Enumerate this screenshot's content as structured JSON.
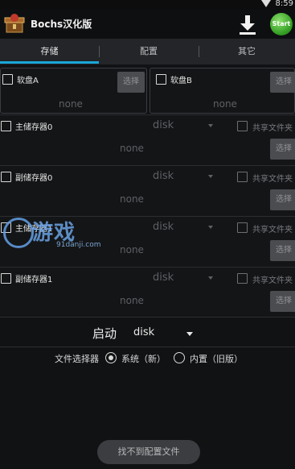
{
  "status": {
    "time": "8:59"
  },
  "app": {
    "title": "Bochs汉化版",
    "start_label": "Start"
  },
  "tabs": [
    {
      "label": "存储"
    },
    {
      "label": "配置"
    },
    {
      "label": "其它"
    }
  ],
  "floppy": [
    {
      "label": "软盘A",
      "button": "选择",
      "value": "none"
    },
    {
      "label": "软盘B",
      "button": "选择",
      "value": "none"
    }
  ],
  "drives": [
    {
      "label": "主储存器0",
      "type": "disk",
      "share": "共享文件夹",
      "button": "选择",
      "value": "none"
    },
    {
      "label": "副储存器0",
      "type": "disk",
      "share": "共享文件夹",
      "button": "选择",
      "value": "none"
    },
    {
      "label": "主储存器1",
      "type": "disk",
      "share": "共享文件夹",
      "button": "选择",
      "value": "none"
    },
    {
      "label": "副储存器1",
      "type": "disk",
      "share": "共享文件夹",
      "button": "选择",
      "value": "none"
    }
  ],
  "boot": {
    "label": "启动",
    "value": "disk"
  },
  "file_selector": {
    "label": "文件选择器",
    "options": [
      "系统（新）",
      "内置（旧版）"
    ],
    "selected": 0
  },
  "bottom_button": "找不到配置文件",
  "watermark": {
    "text": "游戏",
    "sub": "91danji.com"
  }
}
